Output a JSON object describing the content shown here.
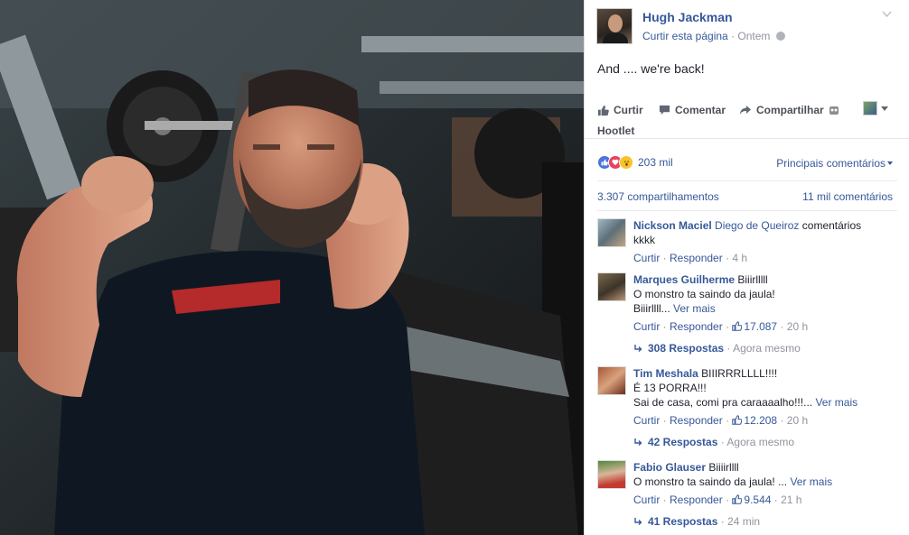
{
  "post": {
    "page_name": "Hugh Jackman",
    "like_page": "Curtir esta página",
    "time": "Ontem",
    "text": "And .... we're back!"
  },
  "actions": {
    "like": "Curtir",
    "comment": "Comentar",
    "share": "Compartilhar",
    "hootlet": "Hootlet"
  },
  "stats": {
    "reactions": "203 mil",
    "sort": "Principais comentários",
    "shares": "3.307 compartilhamentos",
    "comments": "11 mil comentários"
  },
  "comments": [
    {
      "name": "Nickson Maciel",
      "tag": "Diego de Queiroz",
      "text": "comentários",
      "line2": "kkkk",
      "like": "Curtir",
      "reply": "Responder",
      "time": "4 h"
    },
    {
      "name": "Marques Guilherme",
      "text": "Biiirlllll",
      "line2": "O monstro ta saindo da jaula!",
      "line3": "Biiirllll...",
      "more": "Ver mais",
      "like": "Curtir",
      "reply": "Responder",
      "likes": "17.087",
      "time": "20 h",
      "replies": "308 Respostas",
      "replies_time": "Agora mesmo"
    },
    {
      "name": "Tim Meshala",
      "text": "BIIIRRRLLLL!!!!",
      "line2": "É 13 PORRA!!!",
      "line3": "Sai de casa, comi pra caraaaalho!!!...",
      "more": "Ver mais",
      "like": "Curtir",
      "reply": "Responder",
      "likes": "12.208",
      "time": "20 h",
      "replies": "42 Respostas",
      "replies_time": "Agora mesmo"
    },
    {
      "name": "Fabio Glauser",
      "text": "Biiiirllll",
      "line2": "O monstro ta saindo da jaula! ...",
      "more": "Ver mais",
      "like": "Curtir",
      "reply": "Responder",
      "likes": "9.544",
      "time": "21 h",
      "replies": "41 Respostas",
      "replies_time": "24 min"
    }
  ],
  "colors": {
    "link": "#365899",
    "muted": "#90949c",
    "text": "#1d2129"
  }
}
